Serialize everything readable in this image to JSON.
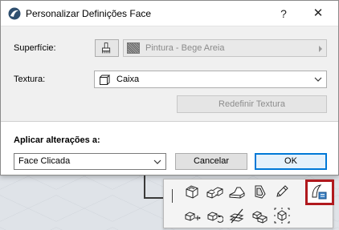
{
  "window": {
    "title": "Personalizar Definições Face",
    "help_glyph": "?",
    "close_glyph": "✕"
  },
  "surface": {
    "label": "Superfície:",
    "value": "Pintura - Bege Areia"
  },
  "texture": {
    "label": "Textura:",
    "value": "Caixa",
    "redefine_label": "Redefinir Textura"
  },
  "apply": {
    "label": "Aplicar alterações a:",
    "value": "Face Clicada"
  },
  "buttons": {
    "cancel_label": "Cancelar",
    "ok_label": "OK"
  },
  "toolbar": {
    "row1": [
      "box-select-icon",
      "blocks-icon",
      "slab-icon",
      "face-shape-icon",
      "pencil-icon",
      "face-settings-icon"
    ],
    "row2": [
      "move-block-icon",
      "rotate-block-icon",
      "slice-icon",
      "stack-blocks-icon",
      "cube-target-icon"
    ],
    "highlight_color": "#b0191e"
  }
}
